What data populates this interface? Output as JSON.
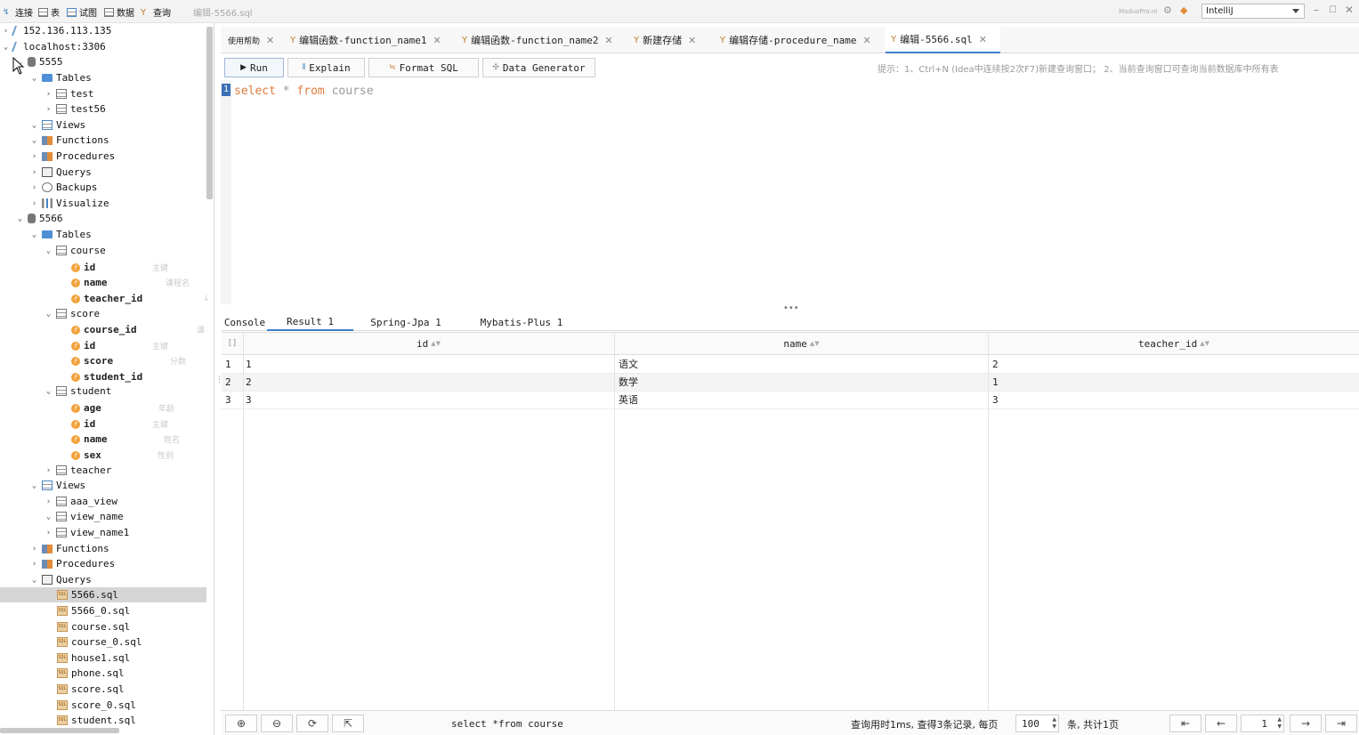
{
  "toolbar": {
    "connect": "连接",
    "table": "表",
    "view": "试图",
    "data": "数据",
    "query": "查询",
    "file_title": "编辑-5566.sql",
    "brand": "MaduoPro.nl",
    "theme_select": "IntelliJ"
  },
  "tree": {
    "conn1": "152.136.113.135",
    "conn2": "localhost:3306",
    "db1": "5555",
    "db1_tables": "Tables",
    "db1_t1": "test",
    "db1_t2": "test56",
    "db1_views": "Views",
    "db1_functions": "Functions",
    "db1_procedures": "Procedures",
    "db1_querys": "Querys",
    "db1_backups": "Backups",
    "db1_visualize": "Visualize",
    "db2": "5566",
    "db2_tables": "Tables",
    "course": "course",
    "course_id": "id",
    "course_id_c": "主键",
    "course_name": "name",
    "course_name_c": "课程名",
    "course_tid": "teacher_id",
    "course_tid_c": "↓",
    "score": "score",
    "score_cid": "course_id",
    "score_cid_c": "课",
    "score_id": "id",
    "score_id_c": "主键",
    "score_score": "score",
    "score_score_c": "分数",
    "score_sid": "student_id",
    "student": "student",
    "student_age": "age",
    "student_age_c": "年龄",
    "student_id": "id",
    "student_id_c": "主键",
    "student_name": "name",
    "student_name_c": "姓名",
    "student_sex": "sex",
    "student_sex_c": "性别",
    "teacher": "teacher",
    "db2_views": "Views",
    "v1": "aaa_view",
    "v2": "view_name",
    "v3": "view_name1",
    "db2_functions": "Functions",
    "db2_procedures": "Procedures",
    "db2_querys": "Querys",
    "q1": "5566.sql",
    "q2": "5566_0.sql",
    "q3": "course.sql",
    "q4": "course_0.sql",
    "q5": "house1.sql",
    "q6": "phone.sql",
    "q7": "score.sql",
    "q8": "score_0.sql",
    "q9": "student.sql"
  },
  "tabs": {
    "help": "使用帮助",
    "t1": "编辑函数-function_name1",
    "t2": "编辑函数-function_name2",
    "t3": "新建存储",
    "t4": "编辑存储-procedure_name",
    "t5": "编辑-5566.sql"
  },
  "editor": {
    "run": "Run",
    "explain": "Explain",
    "format": "Format SQL",
    "generator": "Data Generator",
    "hint": "提示：1、Ctrl+N (Idea中连续按2次F7)新建查询窗口； 2、当前查询窗口可查询当前数据库中所有表",
    "line_number": "1",
    "kw_select": "select",
    "star": " * ",
    "kw_from": "from",
    "table_name": " course"
  },
  "result": {
    "tab_console": "Console",
    "tab_result": "Result 1",
    "tab_jpa": "Spring-Jpa 1",
    "tab_mp": "Mybatis-Plus 1",
    "corner": "[]",
    "columns": [
      "id",
      "name",
      "teacher_id"
    ],
    "rows": [
      {
        "n": "1",
        "id": "1",
        "name": "语文",
        "teacher_id": "2"
      },
      {
        "n": "2",
        "id": "2",
        "name": "数学",
        "teacher_id": "1"
      },
      {
        "n": "3",
        "id": "3",
        "name": "英语",
        "teacher_id": "3"
      }
    ]
  },
  "bottom": {
    "sql": "select *from course",
    "stats": "查询用时1ms, 查得3条记录, 每页",
    "page_size": "100",
    "total": "条, 共计1页",
    "page": "1"
  }
}
